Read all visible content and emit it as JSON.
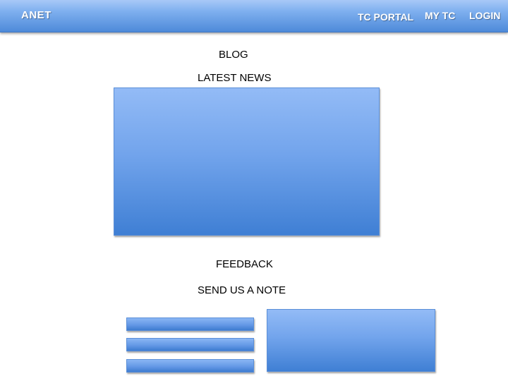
{
  "header": {
    "brand": "ANET",
    "nav": {
      "tc_portal": "TC PORTAL",
      "my_tc": "MY TC",
      "login": "LOGIN"
    }
  },
  "main": {
    "blog_label": "BLOG",
    "latest_news_label": "LATEST NEWS",
    "feedback_label": "FEEDBACK",
    "send_note_label": "SEND US A NOTE"
  },
  "colors": {
    "header_gradient_top": "#a8c9f7",
    "header_gradient_bottom": "#4e8ad9",
    "panel_gradient_top": "#93bbf6",
    "panel_gradient_bottom": "#3f7fd4",
    "background": "#ffffff"
  }
}
